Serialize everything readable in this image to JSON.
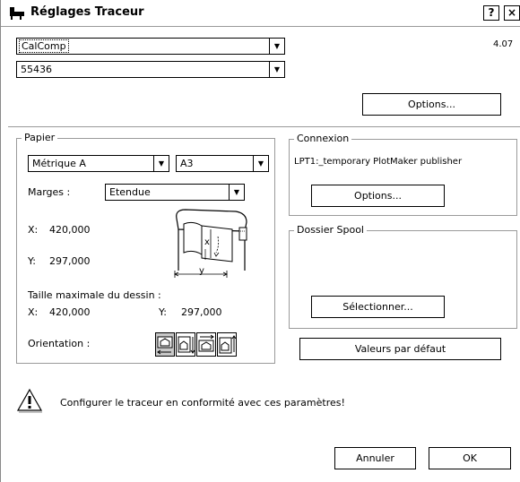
{
  "window": {
    "title": "Réglages Traceur",
    "help_button": "?",
    "close_button": "×",
    "version": "4.07"
  },
  "plotter": {
    "selected": "CalComp"
  },
  "model": {
    "selected": "55436"
  },
  "options_button": "Options...",
  "paper": {
    "legend": "Papier",
    "standard": "Métrique A",
    "size": "A3",
    "margins_label": "Marges :",
    "margins_value": "Etendue",
    "x_label": "X:",
    "x_value": "420,000",
    "y_label": "Y:",
    "y_value": "297,000",
    "illustration": {
      "x_label": "x",
      "y_label": "y"
    },
    "max_title": "Taille maximale du dessin :",
    "max_x_label": "X:",
    "max_x_value": "420,000",
    "max_y_label": "Y:",
    "max_y_value": "297,000",
    "orientation_label": "Orientation :"
  },
  "connection": {
    "legend": "Connexion",
    "port": "LPT1:_temporary PlotMaker publisher",
    "options_button": "Options..."
  },
  "spool": {
    "legend": "Dossier Spool",
    "select_button": "Sélectionner..."
  },
  "defaults_button": "Valeurs par défaut",
  "message": "Configurer le traceur en conformité avec ces paramètres!",
  "footer": {
    "cancel_button": "Annuler",
    "ok_button": "OK"
  },
  "icons": [
    "plotter-title-icon",
    "chevron-down-icon",
    "plotter-illustration-icon",
    "orientation-icons",
    "warning-icon"
  ]
}
